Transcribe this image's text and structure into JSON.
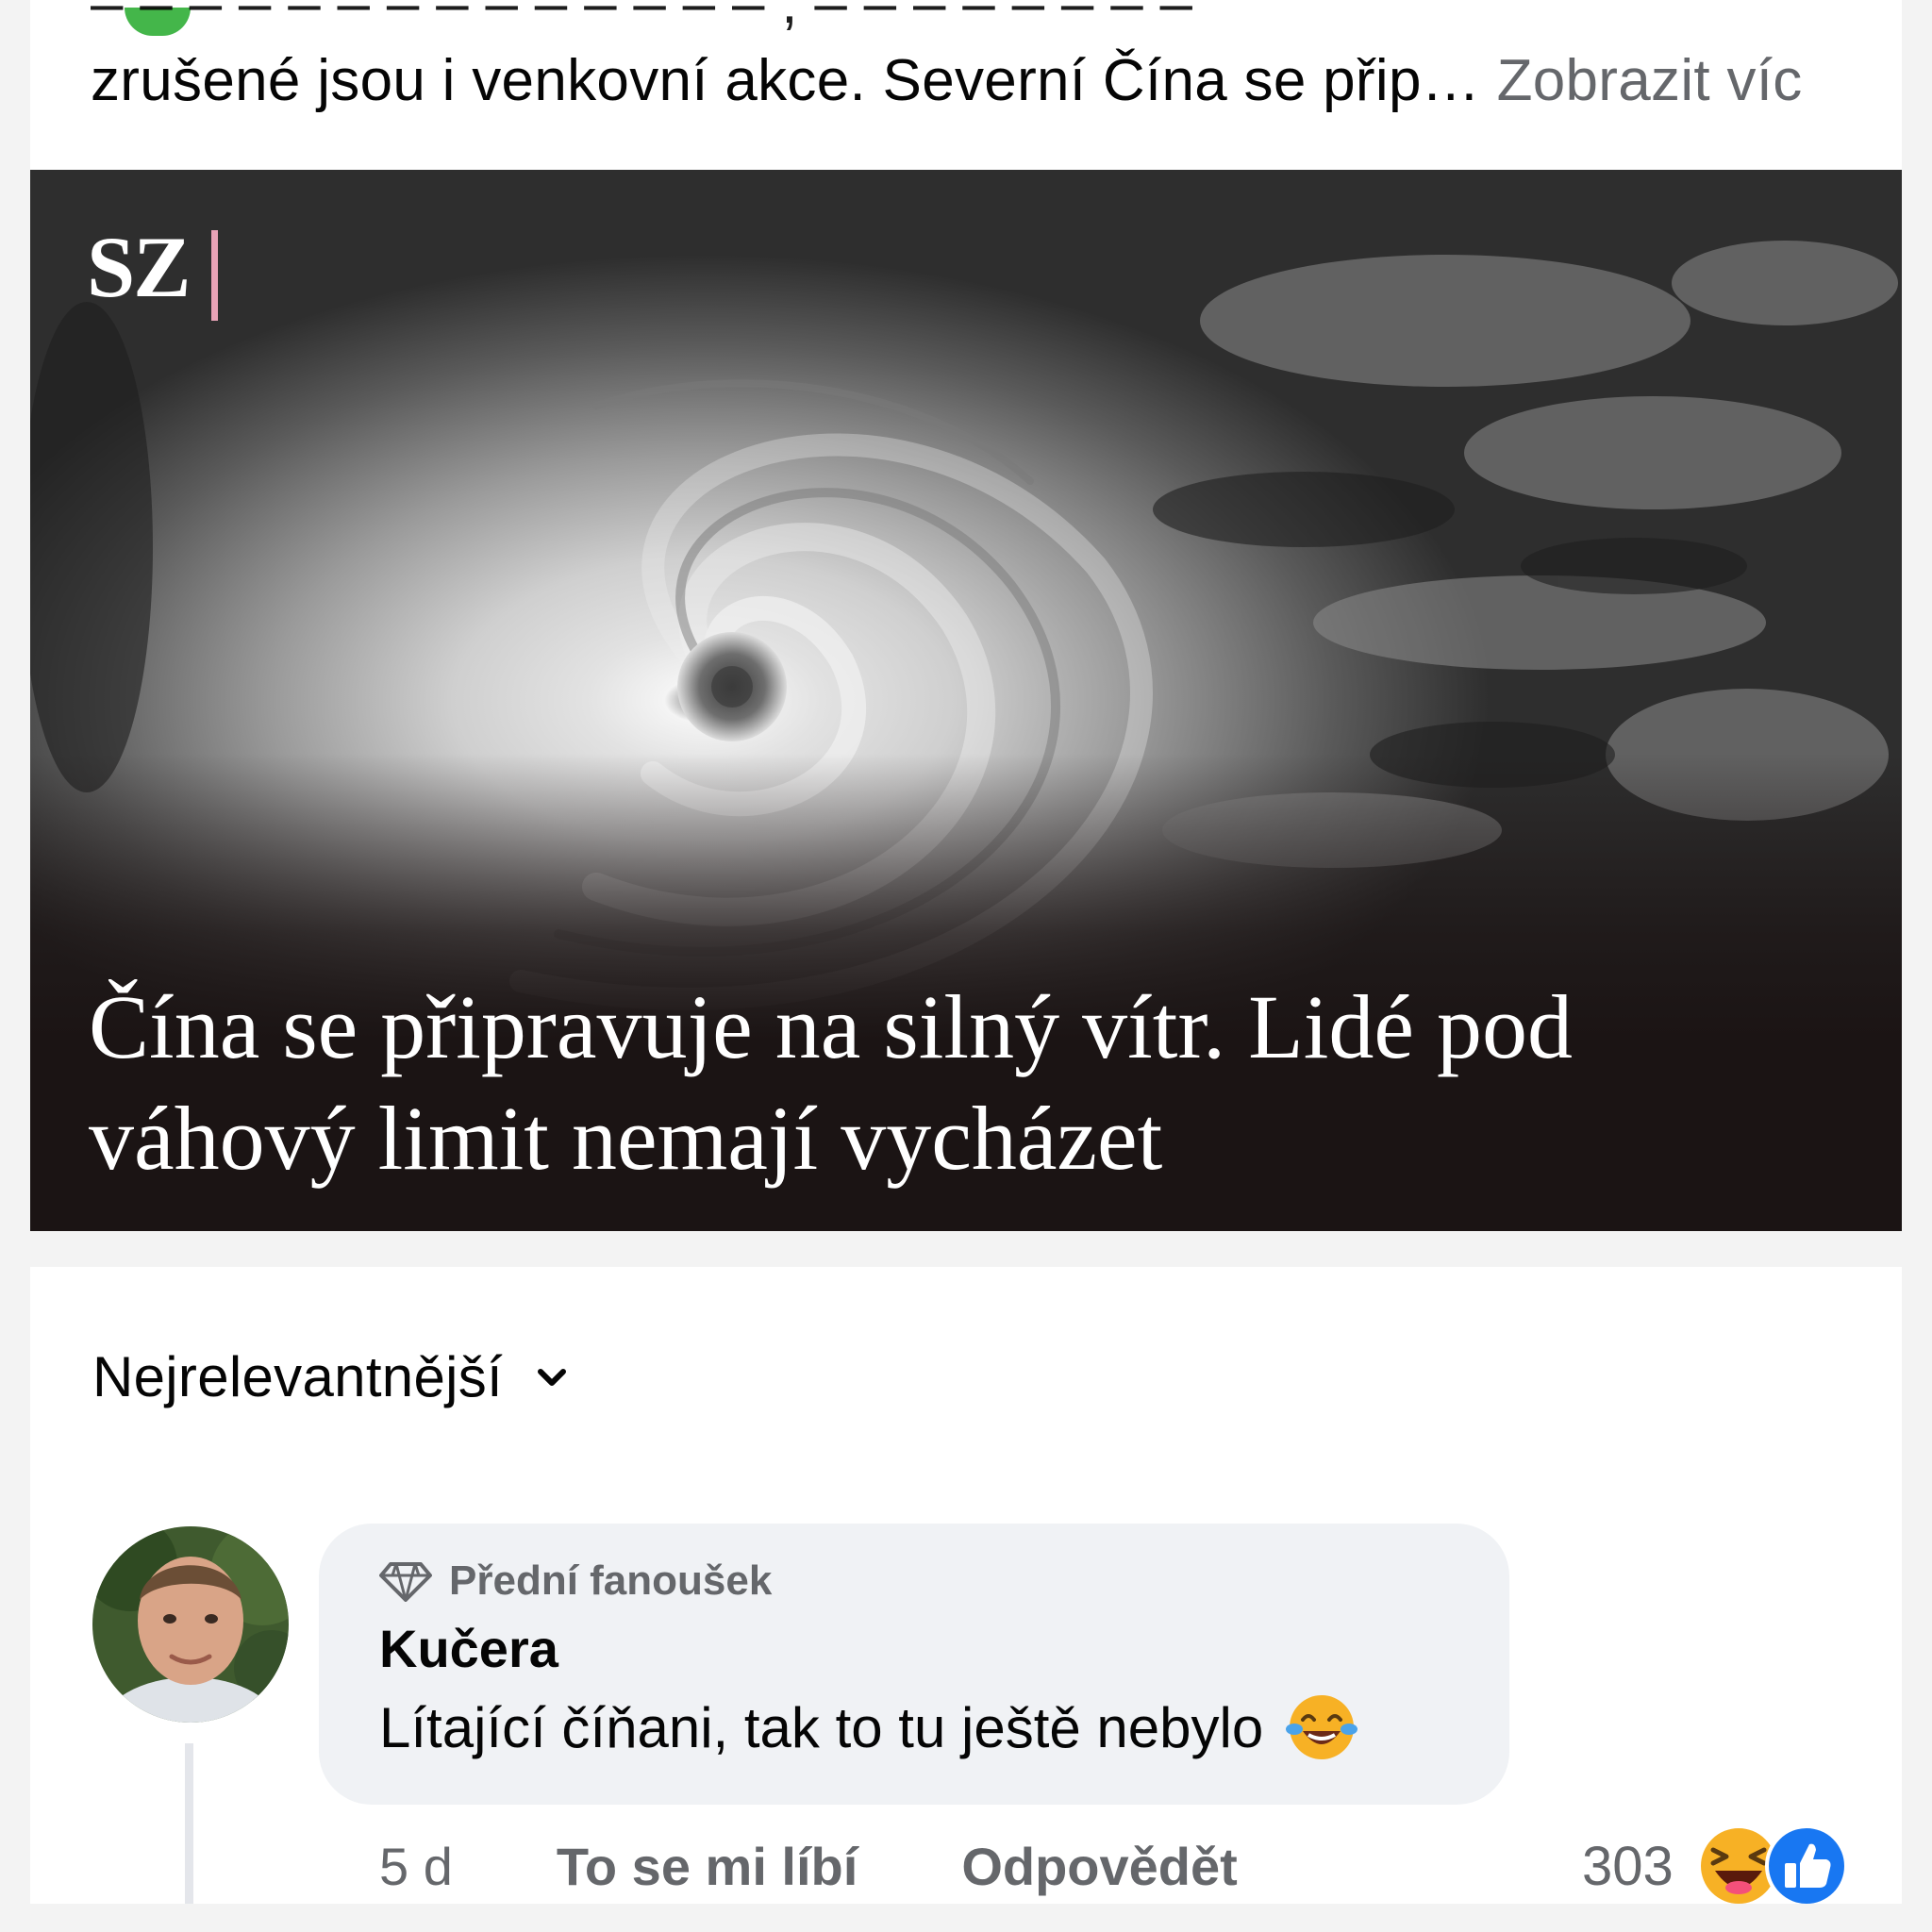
{
  "post": {
    "clipped_line": "– – –  – – – – – – – – – – –  ,  – – – – – – – – ",
    "text": "zrušené jsou i venkovní akce. Severní Čína se přip…",
    "see_more": "Zobrazit víc"
  },
  "preview": {
    "logo": "SZ",
    "headline_line1": "Čína se připravuje na silný vítr. Lidé pod",
    "headline_line2": "váhový limit nemají vycházet"
  },
  "comments": {
    "sort_label": "Nejrelevantnější",
    "items": [
      {
        "badge": "Přední fanoušek",
        "author": "Kučera",
        "text": "Lítající číňani, tak to tu ještě nebylo",
        "text_emoji": "face-with-tears-of-joy-icon",
        "time": "5 d",
        "like_label": "To se mi líbí",
        "reply_label": "Odpovědět",
        "reaction_count": "303",
        "reaction_icons": [
          "haha-reaction-icon",
          "like-reaction-icon"
        ]
      }
    ]
  },
  "colors": {
    "text_primary": "#050505",
    "text_secondary": "#65676b",
    "bubble": "#f0f2f5",
    "like_blue": "#1877f2",
    "haha_yellow": "#f7b125",
    "logo_accent": "#e8a3b7"
  }
}
